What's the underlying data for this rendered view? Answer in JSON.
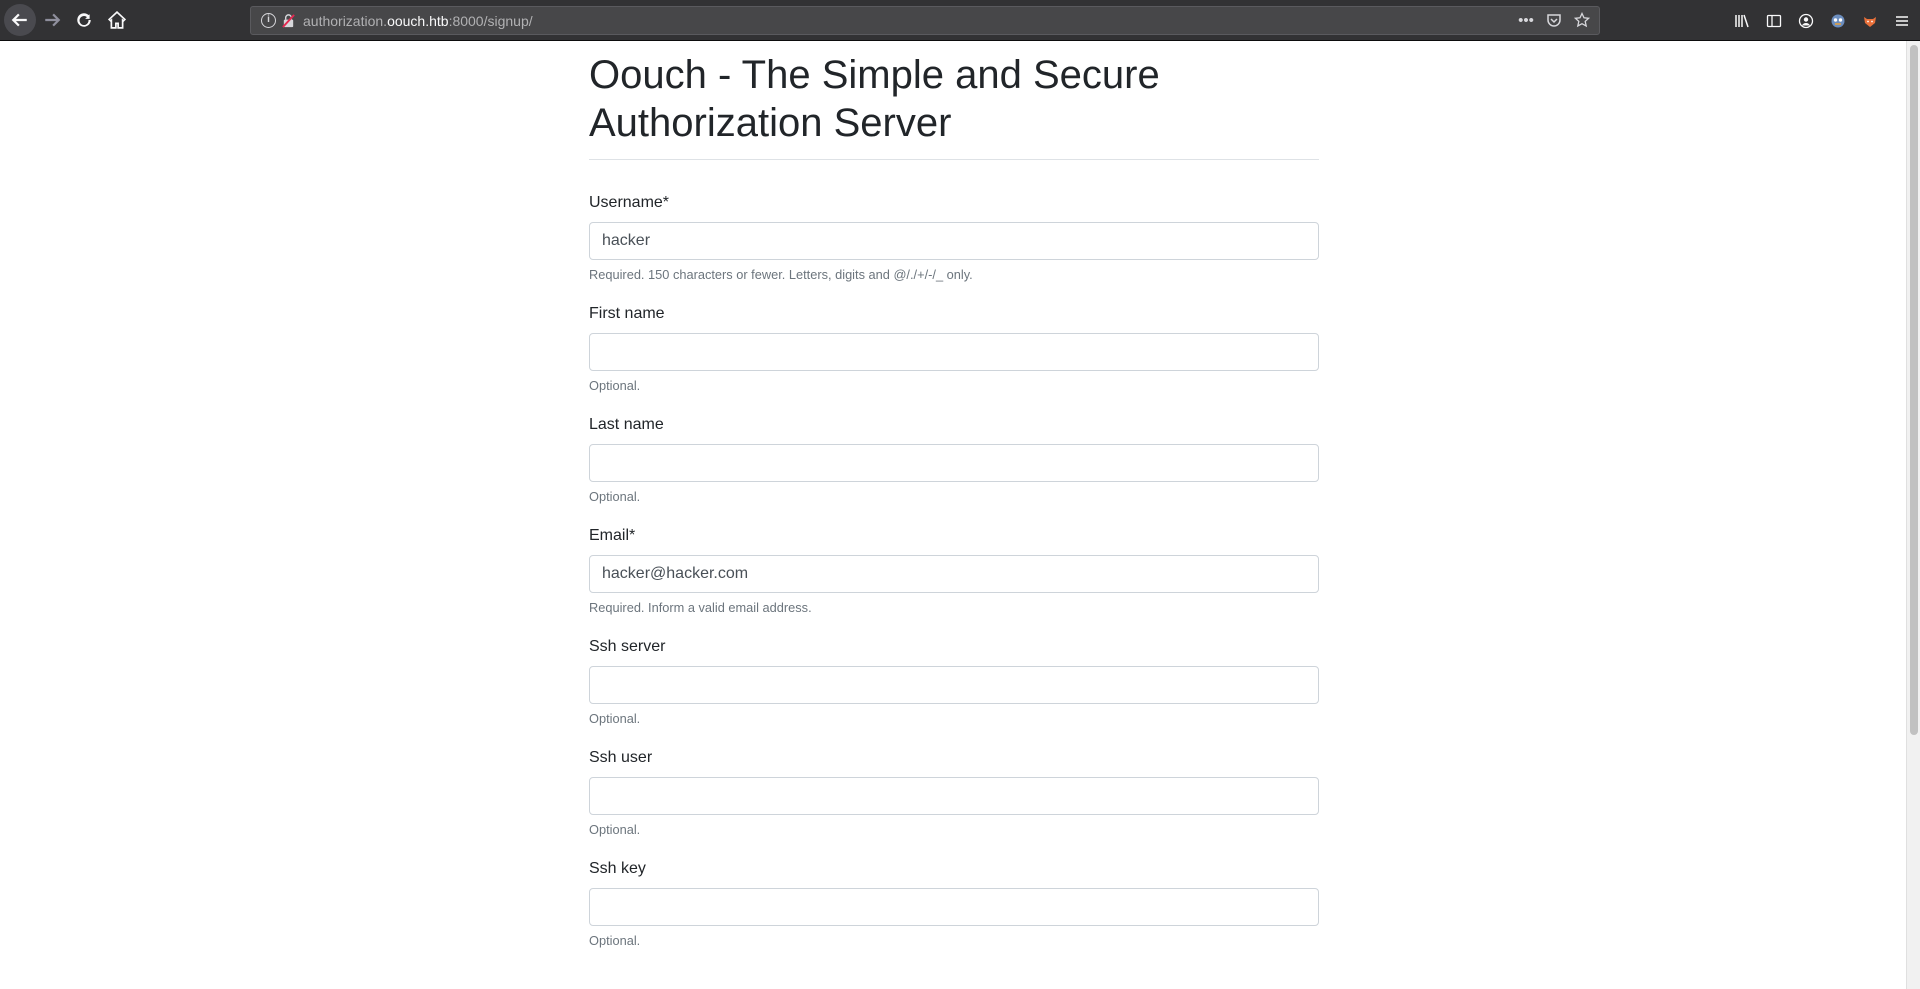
{
  "browser": {
    "url_prefix": "authorization.",
    "url_host": "oouch.htb",
    "url_suffix": ":8000/signup/",
    "page_actions": [
      "more-icon",
      "pocket-icon",
      "bookmark-star-icon"
    ],
    "toolbar_icons": [
      "library-icon",
      "sidebar-icon",
      "account-icon",
      "extension-icon",
      "extension-fox-icon",
      "menu-icon"
    ]
  },
  "page": {
    "title": "Oouch - The Simple and Secure Authorization Server",
    "fields": [
      {
        "label": "Username*",
        "value": "hacker",
        "help": "Required. 150 characters or fewer. Letters, digits and @/./+/-/_ only."
      },
      {
        "label": "First name",
        "value": "",
        "help": "Optional."
      },
      {
        "label": "Last name",
        "value": "",
        "help": "Optional."
      },
      {
        "label": "Email*",
        "value": "hacker@hacker.com",
        "help": "Required. Inform a valid email address."
      },
      {
        "label": "Ssh server",
        "value": "",
        "help": "Optional."
      },
      {
        "label": "Ssh user",
        "value": "",
        "help": "Optional."
      },
      {
        "label": "Ssh key",
        "value": "",
        "help": "Optional."
      }
    ]
  },
  "colors": {
    "chrome_bg": "#323234",
    "text": "#212529",
    "muted": "#6c757d",
    "border": "#ced4da"
  }
}
